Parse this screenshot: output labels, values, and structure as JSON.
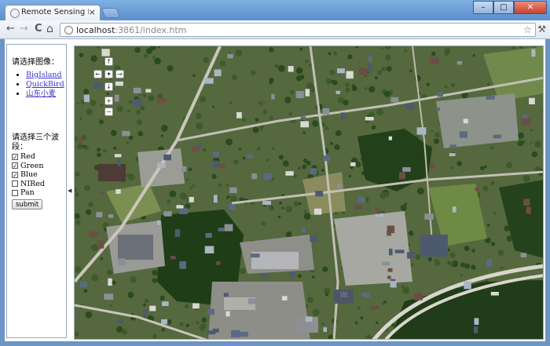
{
  "browser": {
    "tab_title": "Remote Sensing Image:",
    "tab_close": "×",
    "url_host": "localhost",
    "url_rest": ":3861/index.htm",
    "back_icon": "←",
    "forward_icon": "→",
    "reload_icon": "C",
    "home_icon": "⌂",
    "star_icon": "☆",
    "wrench_icon": "🔧",
    "min_icon": "–",
    "max_icon": "□",
    "close_icon": "✕"
  },
  "sidebar": {
    "image_heading": "请选择图像：",
    "images": [
      "BigIsland",
      "QuickBird",
      "山东小麦"
    ],
    "band_heading": "请选择三个波段：",
    "bands": [
      {
        "label": "Red",
        "checked": true
      },
      {
        "label": "Green",
        "checked": true
      },
      {
        "label": "Blue",
        "checked": true
      },
      {
        "label": "NIRed",
        "checked": false
      },
      {
        "label": "Pan",
        "checked": false
      }
    ],
    "submit_label": "submit"
  },
  "map_controls": {
    "pan_up": "↑",
    "pan_left": "←",
    "pan_home": "✦",
    "pan_right": "→",
    "pan_down": "↓",
    "zoom_in": "+",
    "zoom_out": "−"
  },
  "colors": {
    "accent": "#3e33c8",
    "forest": "#1f3d17",
    "grass": "#6f8a45",
    "pavement": "#9a9a96",
    "roof": "#4d5a6e"
  }
}
